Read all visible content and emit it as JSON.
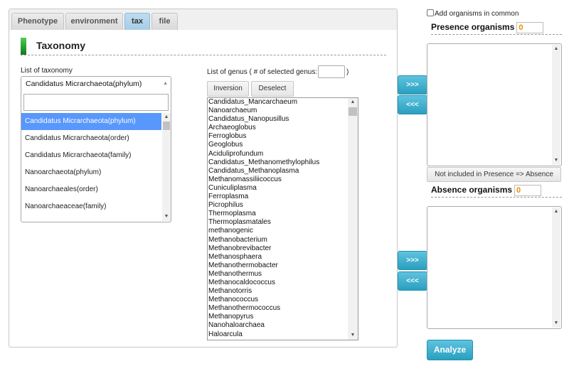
{
  "tabs": [
    {
      "label": "Phenotype",
      "active": false
    },
    {
      "label": "environment",
      "active": false
    },
    {
      "label": "tax",
      "active": true
    },
    {
      "label": "file",
      "active": false
    }
  ],
  "section_title": "Taxonomy",
  "taxonomy": {
    "label": "List of taxonomy",
    "selected": "Candidatus Micrarchaeota(phylum)",
    "search_value": "",
    "options": [
      "Candidatus Micrarchaeota(phylum)",
      "Candidatus Micrarchaeota(order)",
      "Candidatus Micrarchaeota(family)",
      "Nanoarchaeota(phylum)",
      "Nanoarchaeales(order)",
      "Nanoarchaeaceae(family)"
    ]
  },
  "genus": {
    "label_prefix": "List of genus ( # of selected genus:",
    "label_suffix": ")",
    "selected_count": "",
    "inversion_label": "Inversion",
    "deselect_label": "Deselect",
    "items": [
      "Candidatus_Mancarchaeum",
      "Nanoarchaeum",
      "Candidatus_Nanopusillus",
      "Archaeoglobus",
      "Ferroglobus",
      "Geoglobus",
      "Aciduliprofundum",
      "Candidatus_Methanomethylophilus",
      "Candidatus_Methanoplasma",
      "Methanomassiliicoccus",
      "Cuniculiplasma",
      "Ferroplasma",
      "Picrophilus",
      "Thermoplasma",
      "Thermoplasmatales",
      "methanogenic",
      "Methanobacterium",
      "Methanobrevibacter",
      "Methanosphaera",
      "Methanothermobacter",
      "Methanothermus",
      "Methanocaldococcus",
      "Methanotorris",
      "Methanococcus",
      "Methanothermococcus",
      "Methanopyrus",
      "Nanohaloarchaea",
      "Haloarcula"
    ]
  },
  "transfer": {
    "add_label": ">>>",
    "remove_label": "<<<"
  },
  "right": {
    "add_common_label": "Add organisms in common",
    "add_common_checked": false,
    "presence_title": "Presence organisms",
    "presence_count": "0",
    "not_included_label": "Not included in Presence => Absence",
    "absence_title": "Absence organisms",
    "absence_count": "0",
    "analyze_label": "Analyze"
  }
}
